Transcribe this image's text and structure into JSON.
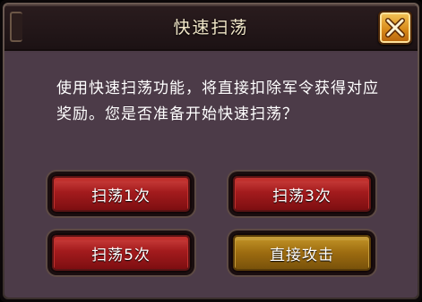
{
  "dialog": {
    "title": "快速扫荡",
    "close_icon": "close-x-icon",
    "message": "使用快速扫荡功能，将直接扣除军令获得对应奖励。您是否准备开始快速扫荡？"
  },
  "buttons": {
    "sweep_1": "扫荡1次",
    "sweep_3": "扫荡3次",
    "sweep_5": "扫荡5次",
    "direct_attack": "直接攻击"
  },
  "colors": {
    "red_button": "#a31b1d",
    "gold_button": "#9c6b10",
    "close_button": "#d98b1a",
    "panel_bg": "#4c3b48"
  }
}
